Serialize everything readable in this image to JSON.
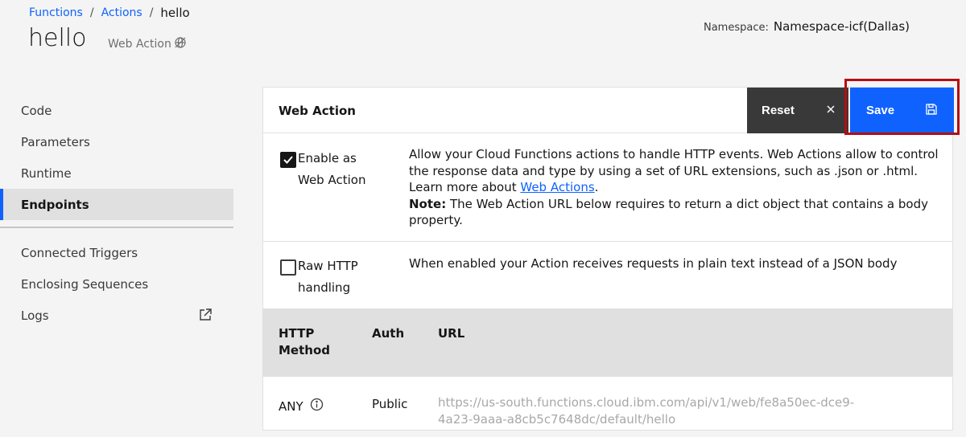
{
  "breadcrumb": {
    "items": [
      "Functions",
      "Actions"
    ],
    "separator": "/",
    "current": "hello"
  },
  "header": {
    "title": "hello",
    "type_tag": "Web Action",
    "namespace_label": "Namespace:",
    "namespace_value": "Namespace-icf(Dallas)"
  },
  "sidebar": {
    "primary": [
      {
        "label": "Code",
        "active": false
      },
      {
        "label": "Parameters",
        "active": false
      },
      {
        "label": "Runtime",
        "active": false
      },
      {
        "label": "Endpoints",
        "active": true
      }
    ],
    "secondary": [
      {
        "label": "Connected Triggers"
      },
      {
        "label": "Enclosing Sequences"
      },
      {
        "label": "Logs",
        "icon": "external-link-icon"
      }
    ]
  },
  "panel": {
    "title": "Web Action",
    "reset_label": "Reset",
    "save_label": "Save",
    "web_action": {
      "checkbox_label": "Enable as Web Action",
      "checked": true,
      "desc_text": "Allow your Cloud Functions actions to handle HTTP events. Web Actions allow to control the response data and type by using a set of URL extensions, such as .json or .html. Learn more about ",
      "link_text": "Web Actions",
      "after_link": ".",
      "note_label": "Note:",
      "note_text": " The Web Action URL below requires to return a dict object that contains a body property."
    },
    "raw_http": {
      "checkbox_label": "Raw HTTP handling",
      "checked": false,
      "desc": "When enabled your Action receives requests in plain text instead of a JSON body"
    },
    "table": {
      "headers": {
        "method": "HTTP Method",
        "auth": "Auth",
        "url": "URL"
      },
      "rows": [
        {
          "method": "ANY",
          "auth": "Public",
          "url": "https://us-south.functions.cloud.ibm.com/api/v1/web/fe8a50ec-dce9-4a23-9aaa-a8cb5c7648dc/default/hello"
        }
      ]
    }
  },
  "colors": {
    "accent": "#0f62fe",
    "reset_bg": "#393939",
    "highlight": "#b50d12"
  }
}
